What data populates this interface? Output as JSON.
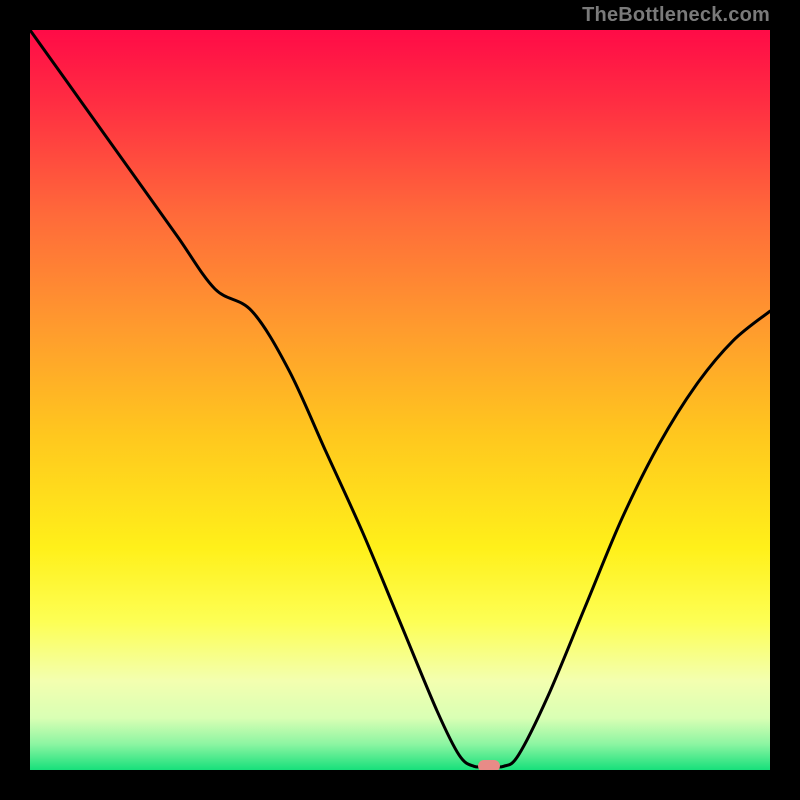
{
  "watermark": "TheBottleneck.com",
  "chart_data": {
    "type": "line",
    "title": "",
    "xlabel": "",
    "ylabel": "",
    "xlim": [
      0,
      100
    ],
    "ylim": [
      0,
      100
    ],
    "grid": false,
    "legend": false,
    "series": [
      {
        "name": "bottleneck-curve",
        "x": [
          0,
          5,
          10,
          15,
          20,
          25,
          30,
          35,
          40,
          45,
          50,
          55,
          58,
          60,
          62,
          64,
          66,
          70,
          75,
          80,
          85,
          90,
          95,
          100
        ],
        "values": [
          100,
          93,
          86,
          79,
          72,
          65,
          62,
          54,
          43,
          32,
          20,
          8,
          2,
          0.5,
          0.5,
          0.5,
          2,
          10,
          22,
          34,
          44,
          52,
          58,
          62
        ]
      }
    ],
    "marker": {
      "x": 62,
      "y": 0.5,
      "color": "#e88b87"
    },
    "gradient_stops": [
      {
        "pos": 0.0,
        "color": "#ff0b47"
      },
      {
        "pos": 0.1,
        "color": "#ff2e42"
      },
      {
        "pos": 0.25,
        "color": "#ff6a3a"
      },
      {
        "pos": 0.4,
        "color": "#ff9a2e"
      },
      {
        "pos": 0.55,
        "color": "#ffc81e"
      },
      {
        "pos": 0.7,
        "color": "#fff01a"
      },
      {
        "pos": 0.8,
        "color": "#fdff55"
      },
      {
        "pos": 0.88,
        "color": "#f3ffb0"
      },
      {
        "pos": 0.93,
        "color": "#d9ffb4"
      },
      {
        "pos": 0.965,
        "color": "#8cf5a2"
      },
      {
        "pos": 1.0,
        "color": "#17e07b"
      }
    ]
  }
}
